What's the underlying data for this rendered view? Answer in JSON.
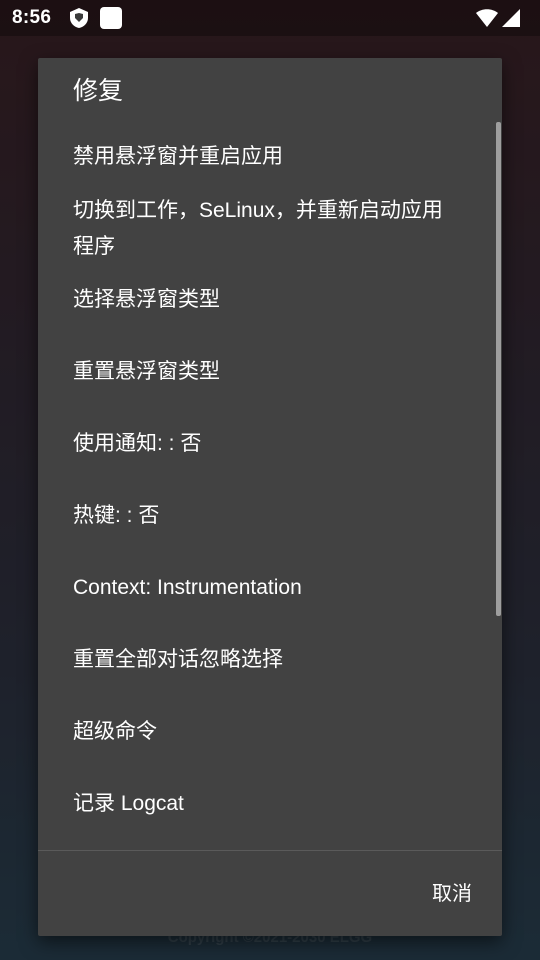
{
  "status_bar": {
    "time": "8:56",
    "icons": [
      "app-shield-icon",
      "notification-square-icon",
      "wifi-icon",
      "cellular-signal-icon"
    ]
  },
  "background": {
    "footer_text": "Copyright ©2021-2030 ELGG"
  },
  "dialog": {
    "title": "修复",
    "items": [
      {
        "label": "禁用悬浮窗并重启应用"
      },
      {
        "label": "切换到工作，SeLinux，并重新启动应用程序"
      },
      {
        "label": "选择悬浮窗类型"
      },
      {
        "label": "重置悬浮窗类型"
      },
      {
        "label": "使用通知: : 否"
      },
      {
        "label": "热键: : 否"
      },
      {
        "label": "Context: Instrumentation"
      },
      {
        "label": "重置全部对话忽略选择"
      },
      {
        "label": "超级命令"
      },
      {
        "label": "记录 Logcat"
      }
    ],
    "cancel_label": "取消"
  },
  "colors": {
    "dialog_background": "#424242",
    "text": "#ffffff",
    "scrollbar": "#9e9e9e"
  }
}
